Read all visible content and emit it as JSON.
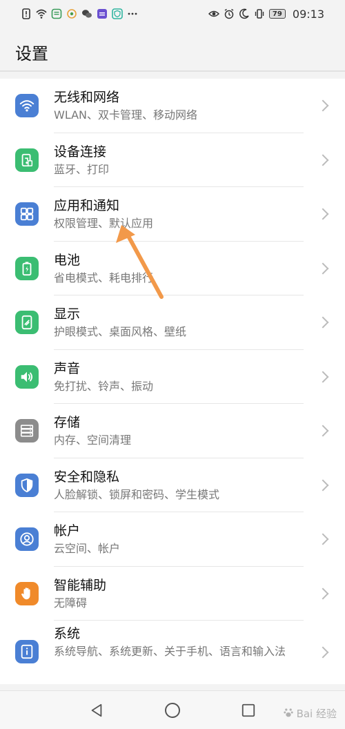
{
  "status_bar": {
    "time": "09:13",
    "battery": "79"
  },
  "page": {
    "title": "设置"
  },
  "items": [
    {
      "title": "无线和网络",
      "subtitle": "WLAN、双卡管理、移动网络",
      "icon": "wifi-icon",
      "color": "#4a7fd4"
    },
    {
      "title": "设备连接",
      "subtitle": "蓝牙、打印",
      "icon": "device-connect-icon",
      "color": "#3bbd72"
    },
    {
      "title": "应用和通知",
      "subtitle": "权限管理、默认应用",
      "icon": "apps-icon",
      "color": "#4a7fd4"
    },
    {
      "title": "电池",
      "subtitle": "省电模式、耗电排行",
      "icon": "battery-icon",
      "color": "#3bbd72"
    },
    {
      "title": "显示",
      "subtitle": "护眼模式、桌面风格、壁纸",
      "icon": "display-icon",
      "color": "#3bbd72"
    },
    {
      "title": "声音",
      "subtitle": "免打扰、铃声、振动",
      "icon": "sound-icon",
      "color": "#3bbd72"
    },
    {
      "title": "存储",
      "subtitle": "内存、空间清理",
      "icon": "storage-icon",
      "color": "#8c8c8c"
    },
    {
      "title": "安全和隐私",
      "subtitle": "人脸解锁、锁屏和密码、学生模式",
      "icon": "shield-icon",
      "color": "#4a7fd4"
    },
    {
      "title": "帐户",
      "subtitle": "云空间、帐户",
      "icon": "account-icon",
      "color": "#4a7fd4"
    },
    {
      "title": "智能辅助",
      "subtitle": "无障碍",
      "icon": "hand-icon",
      "color": "#f08a2a"
    },
    {
      "title": "系统",
      "subtitle": "系统导航、系统更新、关于手机、语言和输入法",
      "icon": "system-info-icon",
      "color": "#4a7fd4"
    }
  ],
  "watermark": {
    "text": "Bai 经验"
  }
}
